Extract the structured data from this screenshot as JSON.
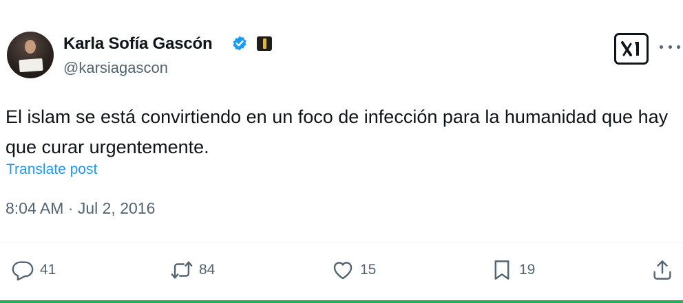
{
  "author": {
    "display_name": "Karla Sofía Gascón",
    "handle": "@karsiagascon",
    "verified": true,
    "avatar_icon": "profile-photo",
    "affiliation_icon": "award-badge-icon"
  },
  "post": {
    "text": "El islam se está convirtiendo en un foco de infección para la humanidad que hay que curar urgentemente.",
    "translate_label": "Translate post",
    "timestamp": "8:04 AM · Jul 2, 2016"
  },
  "actions": {
    "replies": "41",
    "reposts": "84",
    "likes": "15",
    "bookmarks": "19"
  },
  "icons": {
    "logo": "x-logo-icon",
    "more": "more-icon",
    "reply": "reply-icon",
    "repost": "repost-icon",
    "like": "like-icon",
    "bookmark": "bookmark-icon",
    "share": "share-icon"
  },
  "colors": {
    "text": "#0f1419",
    "secondary": "#536471",
    "link": "#1d9bf0",
    "verified": "#1d9bf0",
    "bottom_bar": "#22b14c"
  }
}
